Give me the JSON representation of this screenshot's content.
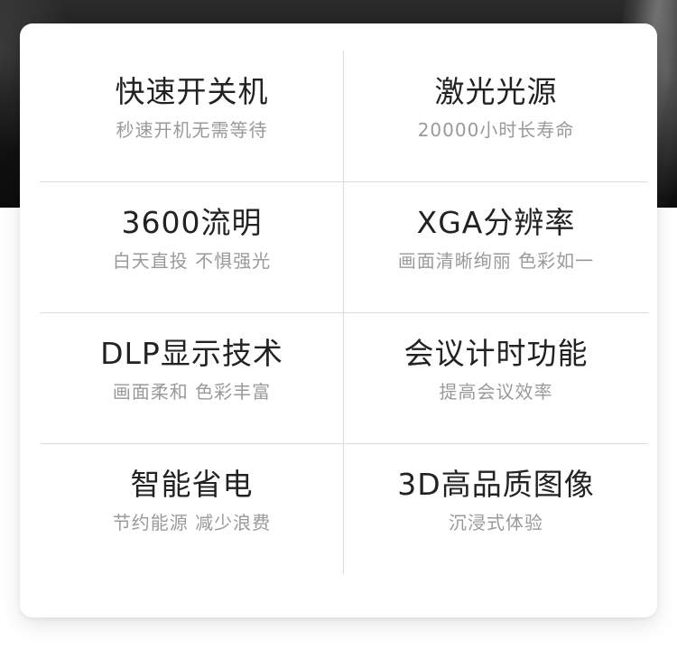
{
  "features": [
    {
      "title": "快速开关机",
      "subtitle": "秒速开机无需等待"
    },
    {
      "title": "激光光源",
      "subtitle": "20000小时长寿命"
    },
    {
      "title": "3600流明",
      "subtitle": "白天直投 不惧强光"
    },
    {
      "title": "XGA分辨率",
      "subtitle": "画面清晰绚丽 色彩如一"
    },
    {
      "title": "DLP显示技术",
      "subtitle": "画面柔和 色彩丰富"
    },
    {
      "title": "会议计时功能",
      "subtitle": "提高会议效率"
    },
    {
      "title": "智能省电",
      "subtitle": "节约能源 减少浪费"
    },
    {
      "title": "3D高品质图像",
      "subtitle": "沉浸式体验"
    }
  ]
}
